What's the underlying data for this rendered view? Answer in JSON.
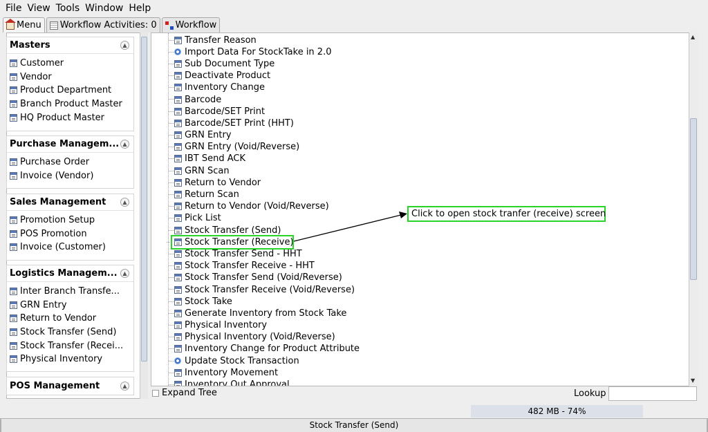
{
  "menubar": {
    "items": [
      "File",
      "View",
      "Tools",
      "Window",
      "Help"
    ]
  },
  "tabs": [
    {
      "label": "Menu",
      "icon": "home-icon"
    },
    {
      "label": "Workflow Activities: 0",
      "icon": "table-icon"
    },
    {
      "label": "Workflow",
      "icon": "workflow-icon"
    }
  ],
  "sidebar": {
    "sections": [
      {
        "title": "Masters",
        "items": [
          "Customer",
          "Vendor",
          "Product Department",
          "Branch Product Master",
          "HQ Product Master"
        ]
      },
      {
        "title": "Purchase Managem...",
        "items": [
          "Purchase Order",
          "Invoice (Vendor)"
        ]
      },
      {
        "title": "Sales Management",
        "items": [
          "Promotion Setup",
          "POS Promotion",
          "Invoice (Customer)"
        ]
      },
      {
        "title": "Logistics Managem...",
        "items": [
          "Inter Branch Transfe...",
          "GRN Entry",
          "Return to Vendor",
          "Stock Transfer (Send)",
          "Stock Transfer (Recei...",
          "Physical Inventory"
        ]
      },
      {
        "title": "POS Management",
        "items": []
      }
    ]
  },
  "tree": {
    "items": [
      {
        "label": "Transfer Reason",
        "icon": "doc"
      },
      {
        "label": "Import Data For StockTake in 2.0",
        "icon": "gear"
      },
      {
        "label": "Sub Document Type",
        "icon": "doc"
      },
      {
        "label": "Deactivate Product",
        "icon": "doc"
      },
      {
        "label": "Inventory Change",
        "icon": "doc"
      },
      {
        "label": "Barcode",
        "icon": "doc"
      },
      {
        "label": "Barcode/SET Print",
        "icon": "doc"
      },
      {
        "label": "Barcode/SET Print (HHT)",
        "icon": "doc"
      },
      {
        "label": "GRN Entry",
        "icon": "doc"
      },
      {
        "label": "GRN Entry (Void/Reverse)",
        "icon": "doc"
      },
      {
        "label": "IBT Send ACK",
        "icon": "doc"
      },
      {
        "label": "GRN Scan",
        "icon": "doc"
      },
      {
        "label": "Return to Vendor",
        "icon": "doc"
      },
      {
        "label": "Return Scan",
        "icon": "doc"
      },
      {
        "label": "Return to Vendor (Void/Reverse)",
        "icon": "doc"
      },
      {
        "label": "Pick List",
        "icon": "doc"
      },
      {
        "label": "Stock Transfer (Send)",
        "icon": "doc"
      },
      {
        "label": "Stock Transfer (Receive)",
        "icon": "doc"
      },
      {
        "label": "Stock Transfer Send - HHT",
        "icon": "doc"
      },
      {
        "label": "Stock Transfer Receive - HHT",
        "icon": "doc"
      },
      {
        "label": "Stock Transfer Send (Void/Reverse)",
        "icon": "doc"
      },
      {
        "label": "Stock Transfer Receive (Void/Reverse)",
        "icon": "doc"
      },
      {
        "label": "Stock Take",
        "icon": "doc"
      },
      {
        "label": "Generate Inventory from Stock Take",
        "icon": "doc"
      },
      {
        "label": "Physical Inventory",
        "icon": "doc"
      },
      {
        "label": "Physical Inventory (Void/Reverse)",
        "icon": "doc"
      },
      {
        "label": "Inventory Change for Product Attribute",
        "icon": "doc"
      },
      {
        "label": "Update Stock Transaction",
        "icon": "gear"
      },
      {
        "label": "Inventory Movement",
        "icon": "doc"
      },
      {
        "label": "Inventory Out Approval",
        "icon": "doc"
      }
    ],
    "highlighted_index": 17
  },
  "annotation": {
    "text": "Click to open stock tranfer (receive) screen",
    "color": "#28d428"
  },
  "bottom": {
    "expand_tree_label": "Expand Tree",
    "lookup_label": "Lookup",
    "lookup_value": "",
    "memory": "482 MB - 74%"
  },
  "status": {
    "text": "Stock Transfer (Send)"
  }
}
